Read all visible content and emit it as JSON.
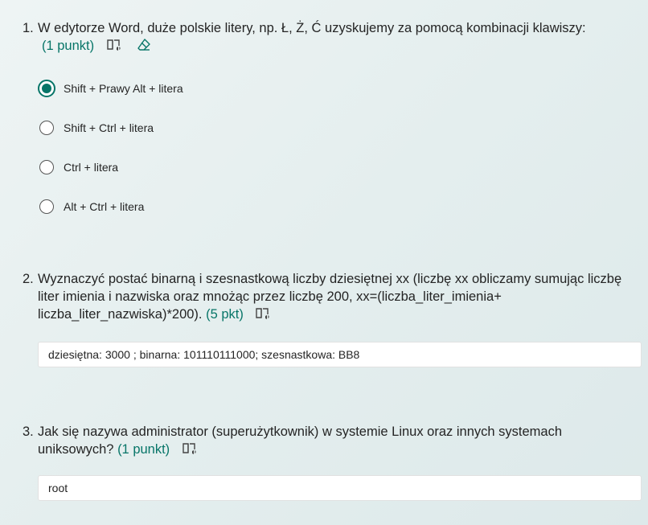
{
  "questions": [
    {
      "number": "1.",
      "text": "W edytorze Word, duże polskie litery, np. Ł, Ż, Ć uzyskujemy za pomocą kombinacji klawiszy:",
      "points": "(1 punkt)",
      "options": [
        {
          "label": "Shift + Prawy Alt + litera",
          "selected": true
        },
        {
          "label": "Shift + Ctrl + litera",
          "selected": false
        },
        {
          "label": "Ctrl + litera",
          "selected": false
        },
        {
          "label": "Alt + Ctrl + litera",
          "selected": false
        }
      ]
    },
    {
      "number": "2.",
      "text": "Wyznaczyć postać binarną i szesnastkową liczby dziesiętnej xx (liczbę xx obliczamy sumując liczbę liter imienia i nazwiska oraz mnożąc przez liczbę 200, xx=(liczba_liter_imienia+ liczba_liter_nazwiska)*200).",
      "points": "(5 pkt)",
      "answer": "dziesiętna: 3000 ; binarna: 101110111000; szesnastkowa: BB8"
    },
    {
      "number": "3.",
      "text": "Jak się nazywa administrator (superużytkownik) w systemie Linux oraz innych systemach uniksowych?",
      "points": "(1 punkt)",
      "answer": "root"
    }
  ],
  "icons": {
    "immersive_reader": "immersive-reader-icon",
    "eraser": "eraser-icon"
  },
  "colors": {
    "accent": "#077568",
    "background": "#e8f0f0",
    "text": "#242424"
  }
}
